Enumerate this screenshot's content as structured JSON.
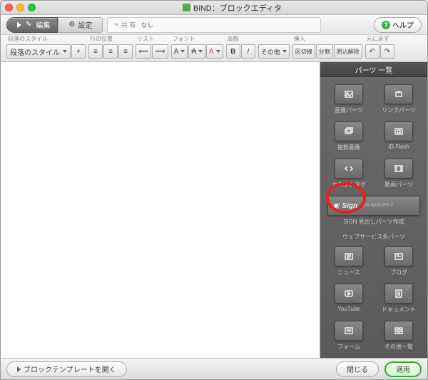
{
  "title": "BiND：ブロックエディタ",
  "toolbar": {
    "edit": "編集",
    "settings": "設定",
    "share_label": "共 有",
    "share_value": "なし",
    "help": "ヘルプ"
  },
  "groups": {
    "paragraph_style": {
      "label": "段落のスタイル",
      "value": "段落のスタイル"
    },
    "line_pos": "行の位置",
    "list": "リスト",
    "font": "フォント",
    "decoration": "装飾",
    "other": "その他",
    "insert": "挿入",
    "undo": "元に戻す",
    "insert_buttons": {
      "sep": "区切線",
      "split": "分割",
      "enclose": "囲込解除"
    }
  },
  "panel": {
    "header": "パーツ 一覧",
    "items": {
      "image": "画像パーツ",
      "link": "リンクパーツ",
      "multi_image": "複数画像",
      "idflash": "ID Flash",
      "custom_tag": "カスタムタグ",
      "video": "動画パーツ",
      "sign": "SiGN 見出しパーツ作成",
      "sign_logo": "Sign",
      "sign_sub": "FOR WEBLIFE 2",
      "web_section": "ウェブサービス系パーツ",
      "news": "ニュース",
      "blog": "ブログ",
      "youtube": "YouTube",
      "document": "ドキュメント",
      "form": "フォーム",
      "other": "その他一覧"
    }
  },
  "footer": {
    "template": "ブロックテンプレートを開く",
    "close": "閉じる",
    "apply": "適用"
  }
}
